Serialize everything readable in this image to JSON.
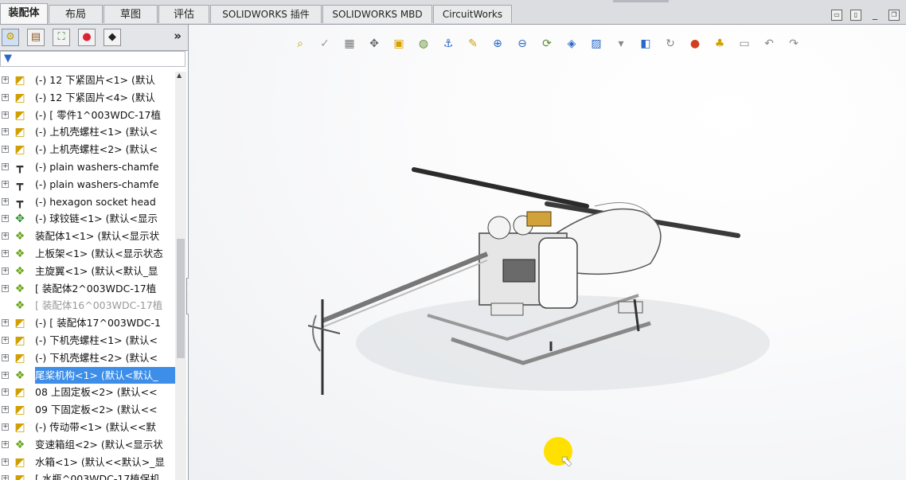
{
  "tabs": [
    {
      "label": "装配体",
      "active": true
    },
    {
      "label": "布局",
      "active": false
    },
    {
      "label": "草图",
      "active": false
    },
    {
      "label": "评估",
      "active": false
    },
    {
      "label": "SOLIDWORKS 插件",
      "active": false
    },
    {
      "label": "SOLIDWORKS MBD",
      "active": false
    },
    {
      "label": "CircuitWorks",
      "active": false
    }
  ],
  "panel": {
    "tab_icons": [
      "feature-manager-icon",
      "property-manager-icon",
      "configuration-manager-icon",
      "appearance-icon",
      "display-manager-icon"
    ],
    "more_label": "»",
    "filter_icon": "filter-icon",
    "tree": [
      {
        "icon": "part",
        "text": "(-) 12  下紧固片<1> (默认"
      },
      {
        "icon": "part",
        "text": "(-) 12  下紧固片<4> (默认"
      },
      {
        "icon": "part",
        "text": "(-) [ 零件1^003WDC-17植"
      },
      {
        "icon": "part",
        "text": "(-) 上机壳螺柱<1> (默认<"
      },
      {
        "icon": "part",
        "text": "(-) 上机壳螺柱<2> (默认<"
      },
      {
        "icon": "bolt",
        "text": "(-) plain washers-chamfe"
      },
      {
        "icon": "bolt",
        "text": "(-) plain washers-chamfe"
      },
      {
        "icon": "bolt",
        "text": "(-) hexagon socket head"
      },
      {
        "icon": "hinge",
        "text": "(-) 球铰链<1> (默认<显示"
      },
      {
        "icon": "asm",
        "text": "装配体1<1> (默认<显示状"
      },
      {
        "icon": "asm",
        "text": "上板架<1> (默认<显示状态"
      },
      {
        "icon": "asm",
        "text": "主旋翼<1> (默认<默认_显"
      },
      {
        "icon": "asm",
        "text": "[ 装配体2^003WDC-17植"
      },
      {
        "icon": "asm",
        "text": "[ 装配体16^003WDC-17植",
        "dim": true
      },
      {
        "icon": "part",
        "text": "(-) [ 装配体17^003WDC-1"
      },
      {
        "icon": "part",
        "text": "(-) 下机壳螺柱<1> (默认<"
      },
      {
        "icon": "part",
        "text": "(-) 下机壳螺柱<2> (默认<"
      },
      {
        "icon": "asm",
        "text": "尾桨机构<1> (默认<默认_",
        "selected": true
      },
      {
        "icon": "part",
        "text": "08  上固定板<2> (默认<<"
      },
      {
        "icon": "part",
        "text": "09 下固定板<2> (默认<<"
      },
      {
        "icon": "part",
        "text": "(-) 传动带<1> (默认<<默"
      },
      {
        "icon": "asm",
        "text": "变速箱组<2> (默认<显示状"
      },
      {
        "icon": "part",
        "text": "水箱<1> (默认<<默认>_显"
      },
      {
        "icon": "part",
        "text": "[ 水瓶^003WDC-17植保机"
      }
    ]
  },
  "view_toolbar": [
    "zoom-to-fit-icon",
    "check-icon",
    "section-view-icon",
    "move-icon",
    "display-style-icon",
    "hide-show-icon",
    "orient-icon",
    "sketch-icon",
    "zoom-area-icon",
    "zoom-previous-icon",
    "rotate-icon",
    "3d-view-icon",
    "view-orientation-icon",
    "view-settings-icon",
    "cube-icon",
    "rotate-around-icon",
    "appearance-icon",
    "scene-icon",
    "monitor-icon",
    "undo-icon",
    "redo-icon"
  ],
  "colors": {
    "selection": "#3d8ee8",
    "cursor_highlight": "#ffe000"
  }
}
